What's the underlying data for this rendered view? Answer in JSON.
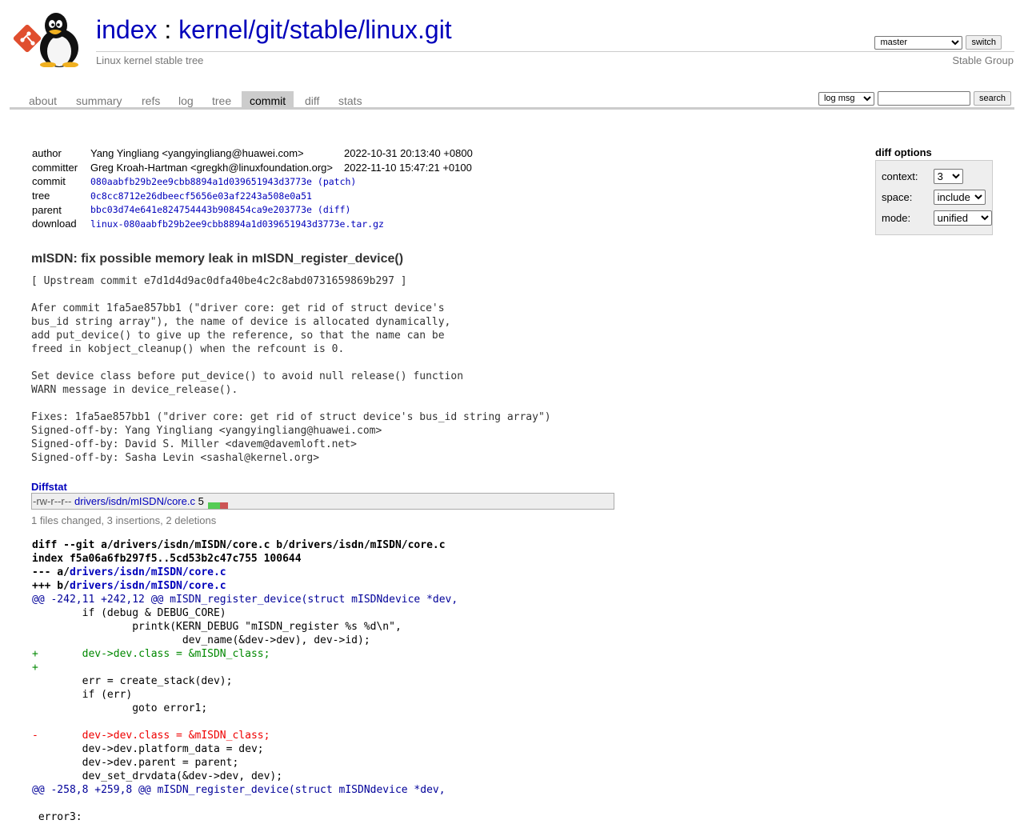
{
  "header": {
    "title_index": "index",
    "title_sep": " : ",
    "title_repo": "kernel/git/stable/linux.git",
    "subtitle": "Linux kernel stable tree",
    "owner": "Stable Group",
    "branch_selected": "master",
    "switch_label": "switch"
  },
  "tabs": [
    {
      "label": "about"
    },
    {
      "label": "summary"
    },
    {
      "label": "refs"
    },
    {
      "label": "log"
    },
    {
      "label": "tree"
    },
    {
      "label": "commit",
      "active": true
    },
    {
      "label": "diff"
    },
    {
      "label": "stats"
    }
  ],
  "search": {
    "mode_selected": "log msg",
    "query": "",
    "button_label": "search"
  },
  "commit_info": {
    "author_label": "author",
    "author": "Yang Yingliang <yangyingliang@huawei.com>",
    "author_date": "2022-10-31 20:13:40 +0800",
    "committer_label": "committer",
    "committer": "Greg Kroah-Hartman <gregkh@linuxfoundation.org>",
    "committer_date": "2022-11-10 15:47:21 +0100",
    "commit_label": "commit",
    "commit": "080aabfb29b2ee9cbb8894a1d039651943d3773e",
    "patch_label": "(patch)",
    "tree_label": "tree",
    "tree": "0c8cc8712e26dbeecf5656e03af2243a508e0a51",
    "parent_label": "parent",
    "parent": "bbc03d74e641e824754443b908454ca9e203773e",
    "diff_label": "(diff)",
    "download_label": "download",
    "download": "linux-080aabfb29b2ee9cbb8894a1d039651943d3773e.tar.gz"
  },
  "diff_options": {
    "heading": "diff options",
    "context_label": "context:",
    "context_value": "3",
    "space_label": "space:",
    "space_value": "include",
    "mode_label": "mode:",
    "mode_value": "unified"
  },
  "message": {
    "subject": "mISDN: fix possible memory leak in mISDN_register_device()",
    "body": "[ Upstream commit e7d1d4d9ac0dfa40be4c2c8abd0731659869b297 ]\n\nAfer commit 1fa5ae857bb1 (\"driver core: get rid of struct device's\nbus_id string array\"), the name of device is allocated dynamically,\nadd put_device() to give up the reference, so that the name can be\nfreed in kobject_cleanup() when the refcount is 0.\n\nSet device class before put_device() to avoid null release() function\nWARN message in device_release().\n\nFixes: 1fa5ae857bb1 (\"driver core: get rid of struct device's bus_id string array\")\nSigned-off-by: Yang Yingliang <yangyingliang@huawei.com>\nSigned-off-by: David S. Miller <davem@davemloft.net>\nSigned-off-by: Sasha Levin <sashal@kernel.org>"
  },
  "diffstat": {
    "heading": "Diffstat",
    "mode": "-rw-r--r--",
    "file": "drivers/isdn/mISDN/core.c",
    "changes": "5",
    "insertions": 3,
    "deletions": 2,
    "summary": "1 files changed, 3 insertions, 2 deletions"
  },
  "diff": {
    "header1": "diff --git a/drivers/isdn/mISDN/core.c b/drivers/isdn/mISDN/core.c",
    "header2": "index f5a06a6fb297f5..5cd53b2c47c755 100644",
    "minus_prefix": "--- a/",
    "plus_prefix": "+++ b/",
    "file_path": "drivers/isdn/mISDN/core.c",
    "lines": [
      {
        "type": "hunk",
        "text": "@@ -242,11 +242,12 @@ mISDN_register_device(struct mISDNdevice *dev,"
      },
      {
        "type": "ctx",
        "text": " \tif (debug & DEBUG_CORE)"
      },
      {
        "type": "ctx",
        "text": " \t\tprintk(KERN_DEBUG \"mISDN_register %s %d\\n\","
      },
      {
        "type": "ctx",
        "text": " \t\t\tdev_name(&dev->dev), dev->id);"
      },
      {
        "type": "add",
        "text": "+\tdev->dev.class = &mISDN_class;"
      },
      {
        "type": "add",
        "text": "+"
      },
      {
        "type": "ctx",
        "text": " \terr = create_stack(dev);"
      },
      {
        "type": "ctx",
        "text": " \tif (err)"
      },
      {
        "type": "ctx",
        "text": " \t\tgoto error1;"
      },
      {
        "type": "ctx",
        "text": " "
      },
      {
        "type": "del",
        "text": "-\tdev->dev.class = &mISDN_class;"
      },
      {
        "type": "ctx",
        "text": " \tdev->dev.platform_data = dev;"
      },
      {
        "type": "ctx",
        "text": " \tdev->dev.parent = parent;"
      },
      {
        "type": "ctx",
        "text": " \tdev_set_drvdata(&dev->dev, dev);"
      },
      {
        "type": "hunk",
        "text": "@@ -258,8 +259,8 @@ mISDN_register_device(struct mISDNdevice *dev,"
      },
      {
        "type": "ctx",
        "text": " "
      },
      {
        "type": "ctx",
        "text": " error3:"
      }
    ]
  }
}
